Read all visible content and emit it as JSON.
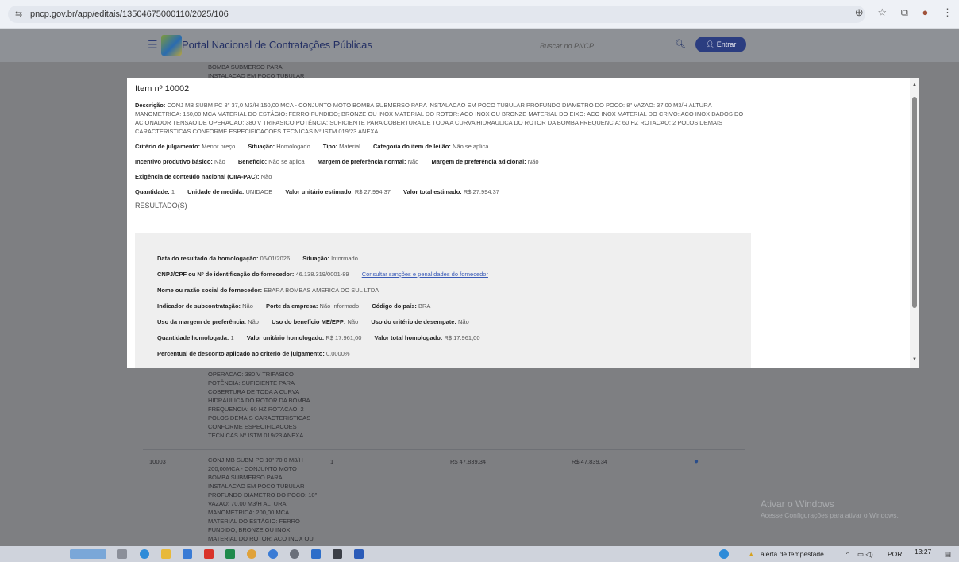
{
  "browser": {
    "url": "pncp.gov.br/app/editais/13504675000110/2025/106",
    "icons": [
      "tune-icon",
      "zoom-icon",
      "star-icon",
      "extensions-icon",
      "profile-icon",
      "menu-icon"
    ]
  },
  "header": {
    "menu_icon": "☰",
    "title": "Portal Nacional de Contratações Públicas",
    "search_placeholder": "Buscar no PNCP",
    "login_label": "Entrar"
  },
  "background": {
    "top_snippet": [
      "BOMBA SUBMERSO PARA",
      "INSTALACAO EM POCO TUBULAR"
    ],
    "mid_snippet": [
      "OPERACAO: 380 V TRIFASICO",
      "POTÊNCIA: SUFICIENTE PARA",
      "COBERTURA DE TODA A CURVA",
      "HIDRAULICA DO ROTOR DA BOMBA",
      "FREQUENCIA: 60 HZ ROTACAO: 2",
      "POLOS DEMAIS CARACTERISTICAS",
      "CONFORME ESPECIFICACOES",
      "TECNICAS Nº ISTM 019/23 ANEXA"
    ],
    "row": {
      "number": "10003",
      "qty": "1",
      "unit_value": "R$ 47.839,34",
      "total_value": "R$ 47.839,34",
      "description": [
        "CONJ MB SUBM PC 10\" 70,0 M3/H",
        "200,00MCA - CONJUNTO MOTO",
        "BOMBA SUBMERSO PARA",
        "INSTALACAO EM POCO TUBULAR",
        "PROFUNDO DIAMETRO DO POCO: 10\"",
        "VAZAO: 70,00 M3/H ALTURA",
        "MANOMETRICA: 200,00 MCA",
        "MATERIAL DO ESTÁGIO: FERRO",
        "FUNDIDO; BRONZE OU INOX",
        "MATERIAL DO ROTOR: ACO INOX OU"
      ]
    },
    "watermark_title": "Ativar o Windows",
    "watermark_sub": "Acesse Configurações para ativar o Windows."
  },
  "modal": {
    "title": "Item nº 10002",
    "description_label": "Descrição:",
    "description": "CONJ MB SUBM PC 8\" 37,0 M3/H 150,00 MCA - CONJUNTO MOTO BOMBA SUBMERSO PARA INSTALACAO EM POCO TUBULAR PROFUNDO DIAMETRO DO POCO: 8\" VAZAO: 37,00 M3/H ALTURA MANOMETRICA: 150,00 MCA MATERIAL DO ESTÁGIO: FERRO FUNDIDO; BRONZE OU INOX MATERIAL DO ROTOR: ACO INOX OU BRONZE MATERIAL DO EIXO: ACO INOX MATERIAL DO CRIVO: ACO INOX DADOS DO ACIONADOR TENSAO DE OPERACAO: 380 V TRIFASICO POTÊNCIA: SUFICIENTE PARA COBERTURA DE TODA A CURVA HIDRAULICA DO ROTOR DA BOMBA FREQUENCIA: 60 HZ ROTACAO: 2 POLOS DEMAIS CARACTERISTICAS CONFORME ESPECIFICACOES TECNICAS Nº ISTM 019/23 ANEXA.",
    "line1": [
      {
        "label": "Critério de julgamento:",
        "value": "Menor preço"
      },
      {
        "label": "Situação:",
        "value": "Homologado"
      },
      {
        "label": "Tipo:",
        "value": "Material"
      },
      {
        "label": "Categoria do item de leilão:",
        "value": "Não se aplica"
      }
    ],
    "line2": [
      {
        "label": "Incentivo produtivo básico:",
        "value": "Não"
      },
      {
        "label": "Benefício:",
        "value": "Não se aplica"
      },
      {
        "label": "Margem de preferência normal:",
        "value": "Não"
      },
      {
        "label": "Margem de preferência adicional:",
        "value": "Não"
      }
    ],
    "line3": [
      {
        "label": "Exigência de conteúdo nacional (CIIA-PAC):",
        "value": "Não"
      }
    ],
    "line4": [
      {
        "label": "Quantidade:",
        "value": "1"
      },
      {
        "label": "Unidade de medida:",
        "value": "UNIDADE"
      },
      {
        "label": "Valor unitário estimado:",
        "value": "R$ 27.994,37"
      },
      {
        "label": "Valor total estimado:",
        "value": "R$ 27.994,37"
      }
    ],
    "results_title": "RESULTADO(S)",
    "results": {
      "r1": [
        {
          "label": "Data do resultado da homologação:",
          "value": "06/01/2026"
        },
        {
          "label": "Situação:",
          "value": "Informado"
        }
      ],
      "r2_label": "CNPJ/CPF ou Nº de identificação do fornecedor:",
      "r2_value": "46.138.319/0001-89",
      "r2_link": "Consultar sanções e penalidades do fornecedor",
      "r3": [
        {
          "label": "Nome ou razão social do fornecedor:",
          "value": "EBARA BOMBAS AMERICA DO SUL LTDA"
        }
      ],
      "r4": [
        {
          "label": "Indicador de subcontratação:",
          "value": "Não"
        },
        {
          "label": "Porte da empresa:",
          "value": "Não Informado"
        },
        {
          "label": "Código do país:",
          "value": "BRA"
        }
      ],
      "r5": [
        {
          "label": "Uso da margem de preferência:",
          "value": "Não"
        },
        {
          "label": "Uso do benefício ME/EPP:",
          "value": "Não"
        },
        {
          "label": "Uso do critério de desempate:",
          "value": "Não"
        }
      ],
      "r6": [
        {
          "label": "Quantidade homologada:",
          "value": "1"
        },
        {
          "label": "Valor unitário homologado:",
          "value": "R$ 17.961,00"
        },
        {
          "label": "Valor total homologado:",
          "value": "R$ 17.961,00"
        }
      ],
      "r7": [
        {
          "label": "Percentual de desconto aplicado ao critério de julgamento:",
          "value": "0,0000%"
        }
      ]
    }
  },
  "taskbar": {
    "weather": "alerta de tempestade",
    "lang": "POR",
    "time": "13:27"
  }
}
